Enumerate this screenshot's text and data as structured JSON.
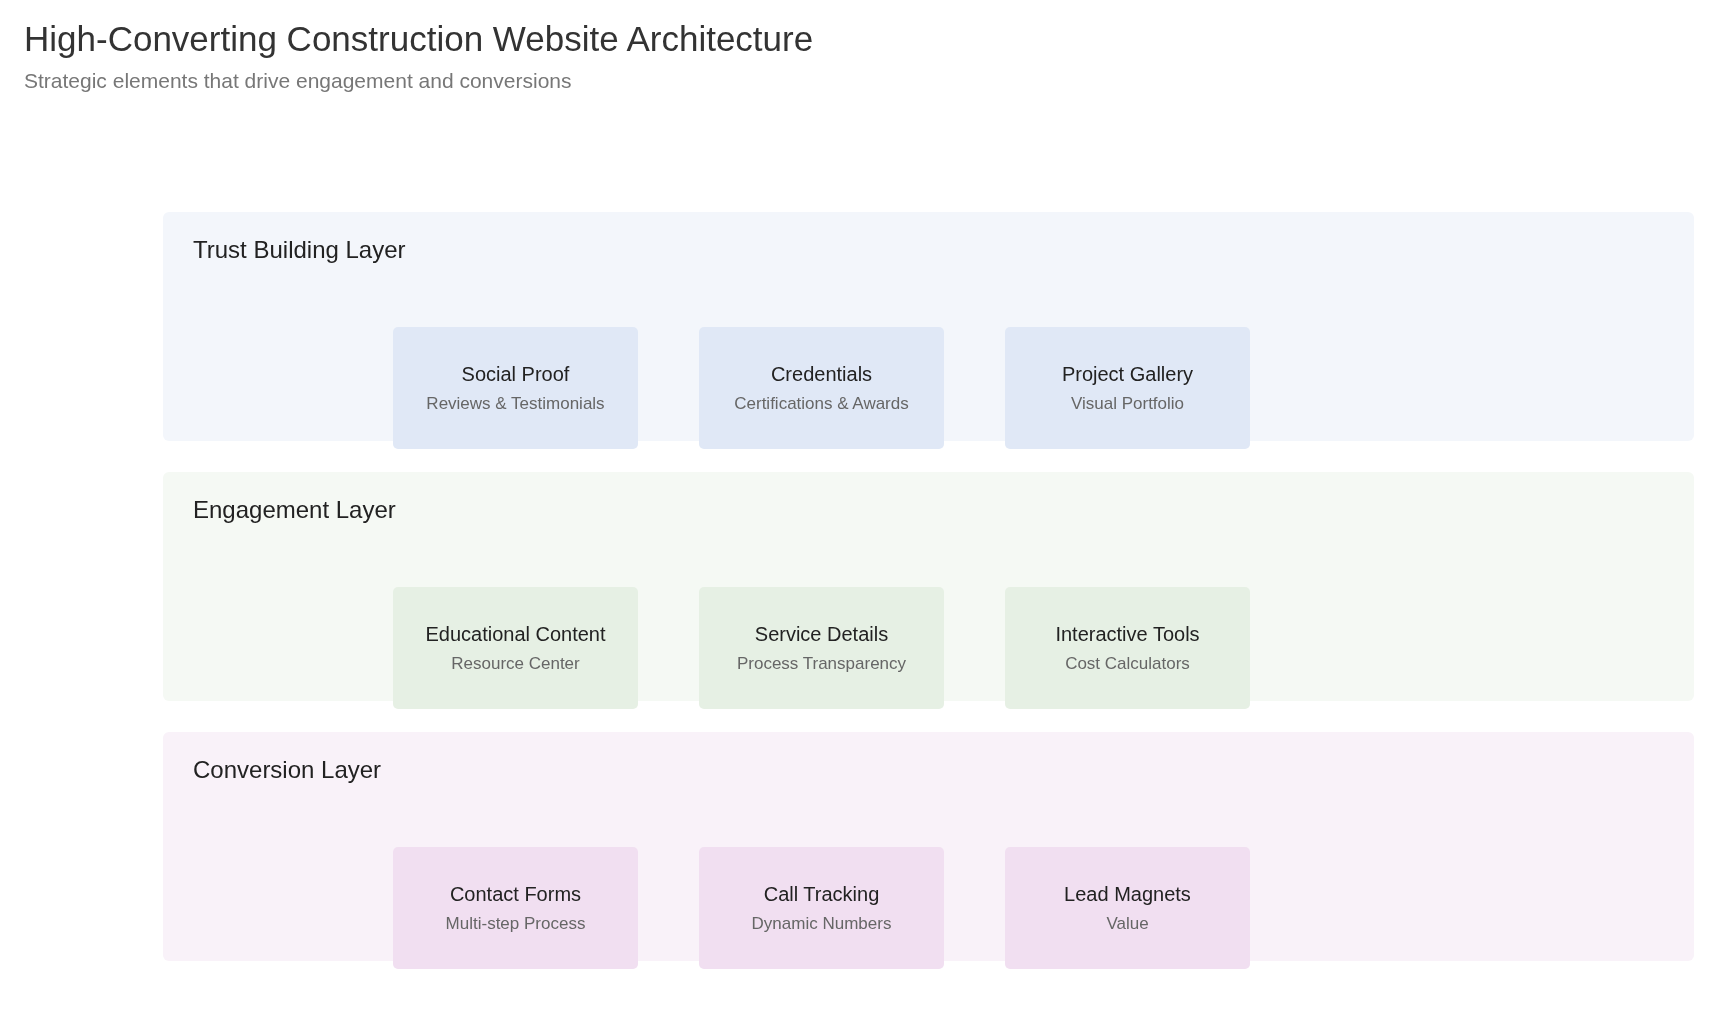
{
  "title": "High-Converting Construction Website Architecture",
  "subtitle": "Strategic elements that drive engagement and conversions",
  "layers": [
    {
      "name": "Trust Building Layer",
      "color": "#e0e8f6",
      "cards": [
        {
          "title": "Social Proof",
          "subtitle": "Reviews & Testimonials"
        },
        {
          "title": "Credentials",
          "subtitle": "Certifications & Awards"
        },
        {
          "title": "Project Gallery",
          "subtitle": "Visual Portfolio"
        }
      ]
    },
    {
      "name": "Engagement Layer",
      "color": "#e6f0e4",
      "cards": [
        {
          "title": "Educational Content",
          "subtitle": "Resource Center"
        },
        {
          "title": "Service Details",
          "subtitle": "Process Transparency"
        },
        {
          "title": "Interactive Tools",
          "subtitle": "Cost Calculators"
        }
      ]
    },
    {
      "name": "Conversion Layer",
      "color": "#f1dff1",
      "cards": [
        {
          "title": "Contact Forms",
          "subtitle": "Multi-step Process"
        },
        {
          "title": "Call Tracking",
          "subtitle": "Dynamic Numbers"
        },
        {
          "title": "Lead Magnets",
          "subtitle": "Value"
        }
      ]
    }
  ]
}
